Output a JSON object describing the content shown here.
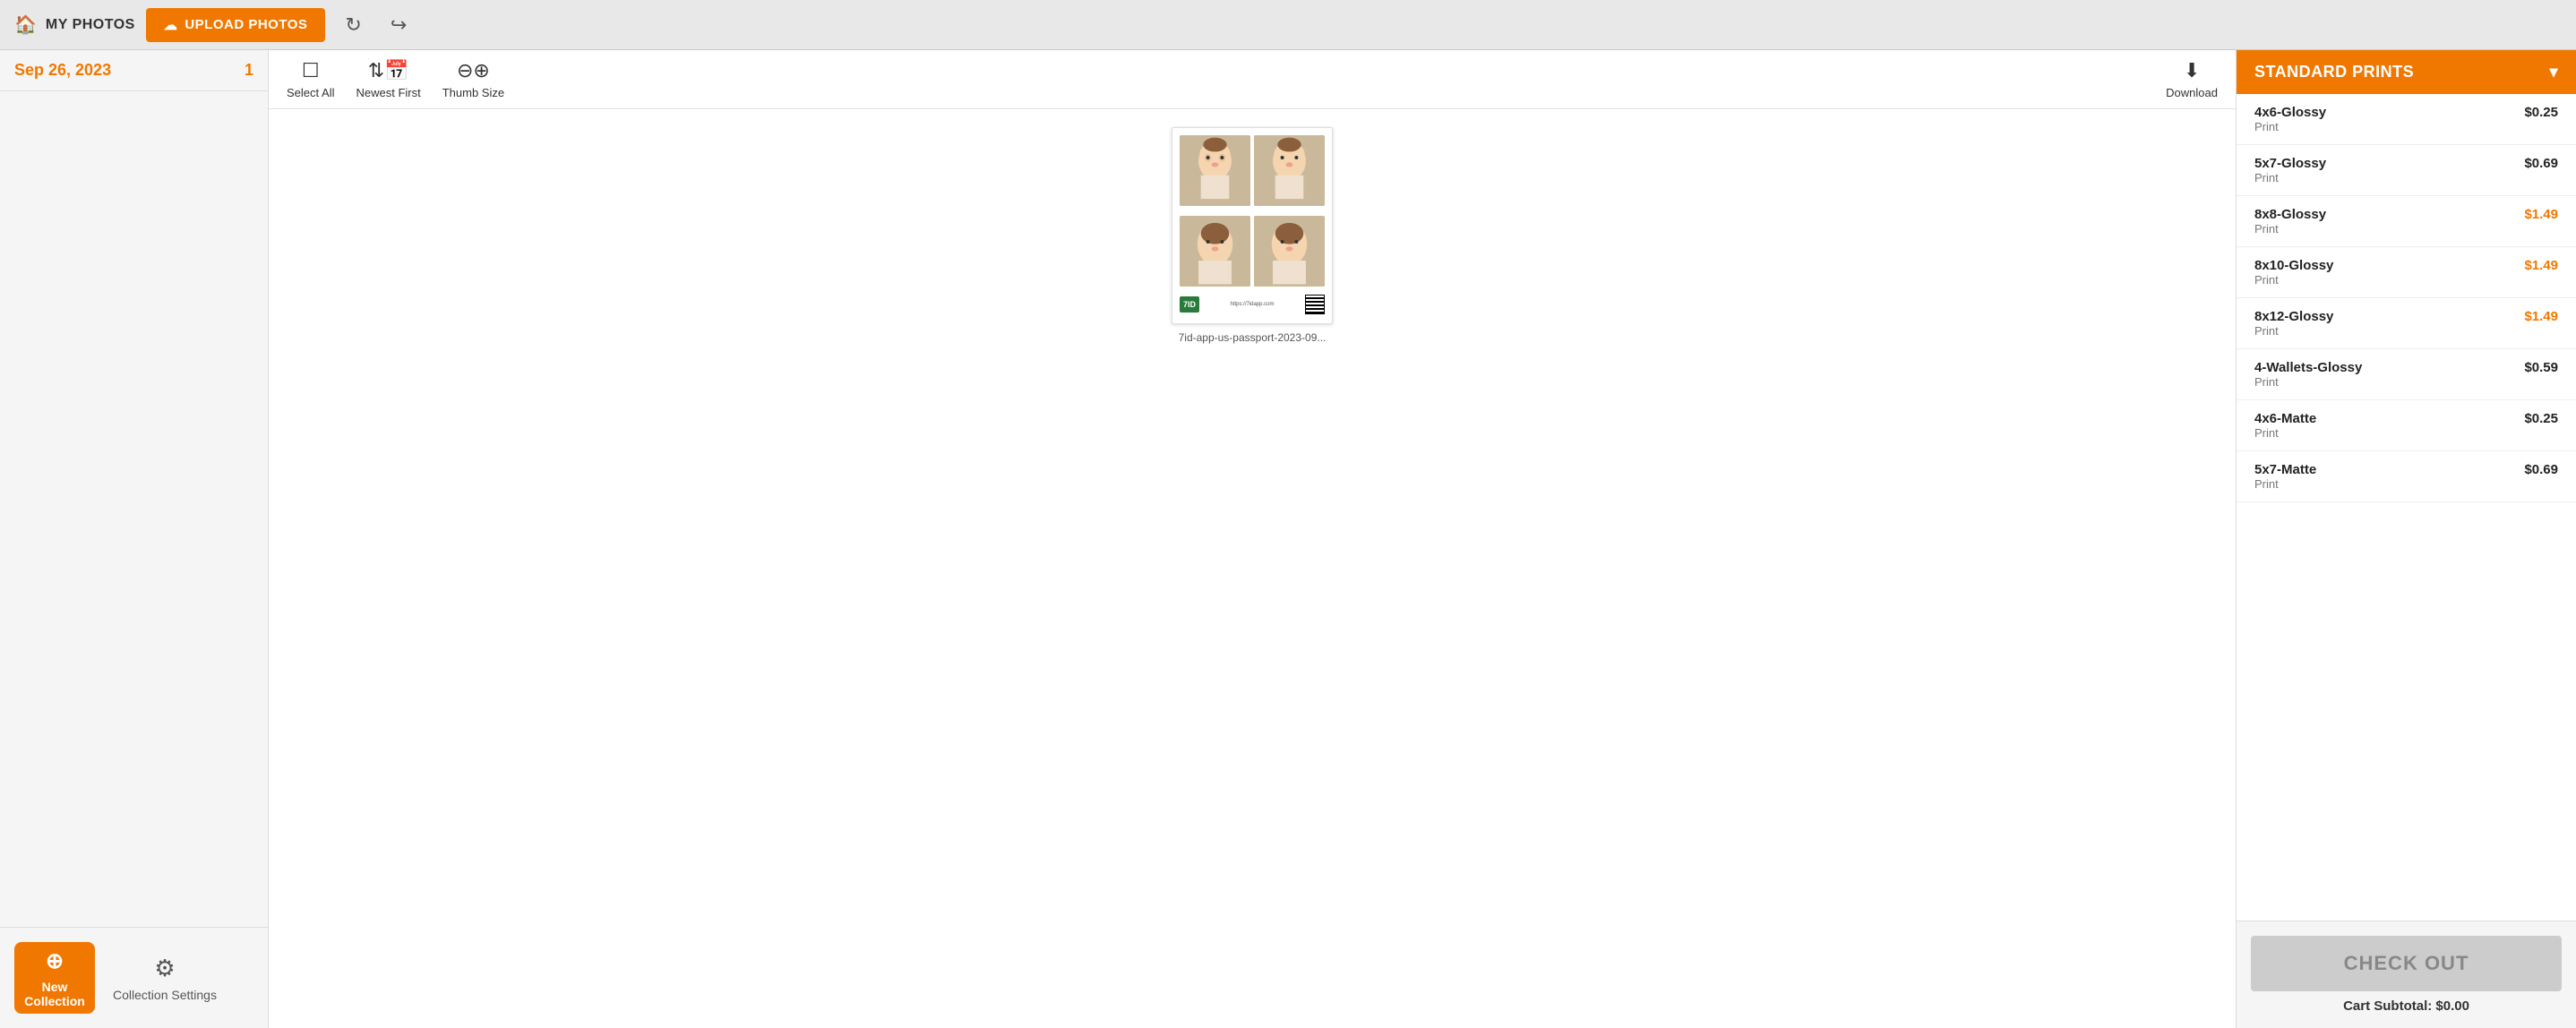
{
  "header": {
    "my_photos_label": "MY PHOTOS",
    "upload_button_label": "UPLOAD PHOTOS",
    "refresh_icon": "↻",
    "share_icon": "↪"
  },
  "sidebar": {
    "date_label": "Sep 26, 2023",
    "photo_count": "1",
    "bottom": {
      "new_collection_plus": "+",
      "new_collection_label": "New Collection",
      "collection_settings_label": "Collection Settings"
    }
  },
  "toolbar": {
    "select_all_label": "Select All",
    "newest_first_label": "Newest First",
    "thumb_size_label": "Thumb Size",
    "download_label": "Download"
  },
  "photo": {
    "filename": "7id-app-us-passport-2023-09...",
    "qr_url": "https://7idapp.com",
    "brand_text": "7ID"
  },
  "right_panel": {
    "header_label": "STANDARD PRINTS",
    "prints": [
      {
        "name": "4x6-Glossy",
        "type": "Print",
        "price": "$0.25",
        "highlighted": false
      },
      {
        "name": "5x7-Glossy",
        "type": "Print",
        "price": "$0.69",
        "highlighted": false
      },
      {
        "name": "8x8-Glossy",
        "type": "Print",
        "price": "$1.49",
        "highlighted": true
      },
      {
        "name": "8x10-Glossy",
        "type": "Print",
        "price": "$1.49",
        "highlighted": true
      },
      {
        "name": "8x12-Glossy",
        "type": "Print",
        "price": "$1.49",
        "highlighted": true
      },
      {
        "name": "4-Wallets-Glossy",
        "type": "Print",
        "price": "$0.59",
        "highlighted": false
      },
      {
        "name": "4x6-Matte",
        "type": "Print",
        "price": "$0.25",
        "highlighted": false
      },
      {
        "name": "5x7-Matte",
        "type": "Print",
        "price": "$0.69",
        "highlighted": false
      }
    ],
    "checkout_label": "CHECK OUT",
    "cart_subtotal_label": "Cart Subtotal: $0.00"
  }
}
